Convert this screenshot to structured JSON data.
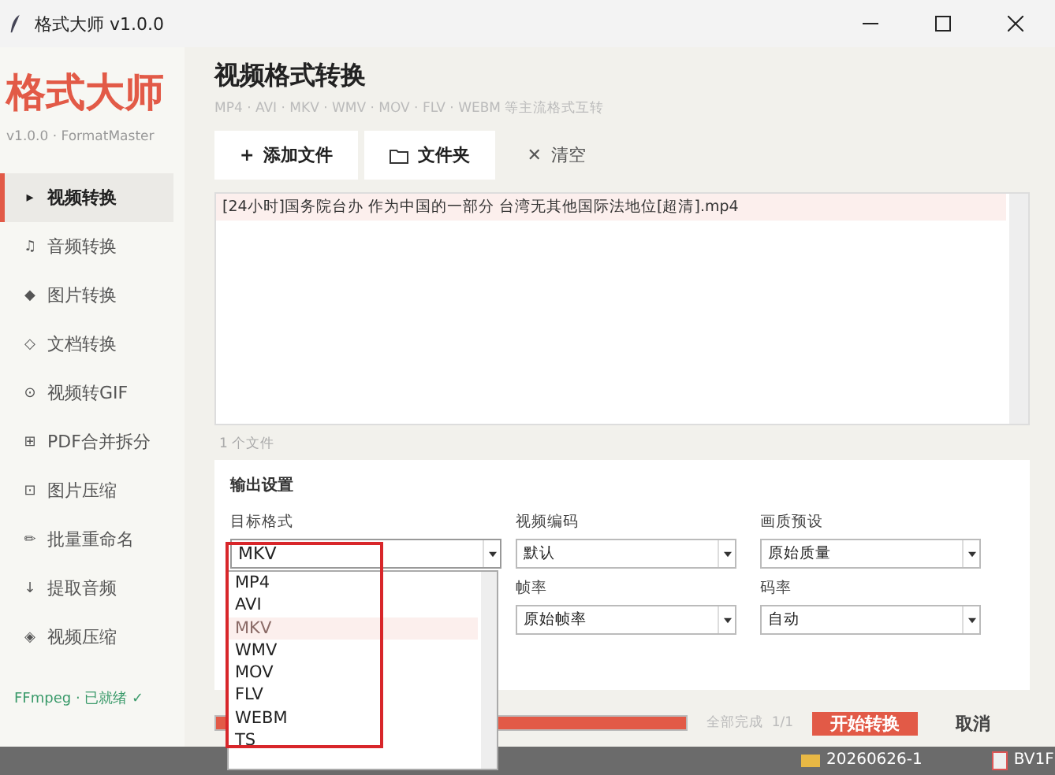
{
  "window": {
    "title": "格式大师 v1.0.0"
  },
  "sidebar": {
    "logo": "格式大师",
    "version": "v1.0.0 · FormatMaster",
    "items": [
      {
        "icon": "▸",
        "label": "视频转换",
        "selected": true
      },
      {
        "icon": "♫",
        "label": "音频转换",
        "selected": false
      },
      {
        "icon": "◆",
        "label": "图片转换",
        "selected": false
      },
      {
        "icon": "◇",
        "label": "文档转换",
        "selected": false
      },
      {
        "icon": "⊙",
        "label": "视频转GIF",
        "selected": false
      },
      {
        "icon": "⊞",
        "label": "PDF合并拆分",
        "selected": false
      },
      {
        "icon": "⊡",
        "label": "图片压缩",
        "selected": false
      },
      {
        "icon": "✏",
        "label": "批量重命名",
        "selected": false
      },
      {
        "icon": "↓",
        "label": "提取音频",
        "selected": false
      },
      {
        "icon": "◈",
        "label": "视频压缩",
        "selected": false
      }
    ],
    "status": "FFmpeg · 已就绪 ✓"
  },
  "header": {
    "title": "视频格式转换",
    "subtitle": "MP4 · AVI · MKV · WMV · MOV · FLV · WEBM 等主流格式互转"
  },
  "toolbar": [
    {
      "kind": "add",
      "icon": "+",
      "label": "添加文件"
    },
    {
      "kind": "folder",
      "label": "文件夹"
    },
    {
      "kind": "clear",
      "icon": "✕",
      "label": "清空"
    }
  ],
  "files": [
    {
      "name": "[24小时]国务院台办 作为中国的一部分 台湾无其他国际法地位[超清].mp4",
      "selected": true
    }
  ],
  "file_count": "1 个文件",
  "settings": {
    "title": "输出设置",
    "fields": [
      {
        "label": "目标格式",
        "value": "MKV",
        "open": true
      },
      {
        "label": "视频编码",
        "value": "默认",
        "open": false
      },
      {
        "label": "画质预设",
        "value": "原始质量",
        "open": false
      },
      {
        "label": "帧率",
        "value": "原始帧率",
        "open": false
      },
      {
        "label": "码率",
        "value": "自动",
        "open": false
      }
    ]
  },
  "format_options": [
    {
      "label": "MP4",
      "selected": false
    },
    {
      "label": "AVI",
      "selected": false
    },
    {
      "label": "MKV",
      "selected": true
    },
    {
      "label": "WMV",
      "selected": false
    },
    {
      "label": "MOV",
      "selected": false
    },
    {
      "label": "FLV",
      "selected": false
    },
    {
      "label": "WEBM",
      "selected": false
    },
    {
      "label": "TS",
      "selected": false
    }
  ],
  "progress": {
    "level": 1,
    "text": "全部完成  1/1"
  },
  "actions": {
    "start": "开始转换",
    "cancel": "取消"
  },
  "desktop": [
    {
      "kind": "folder",
      "label": "20260626-1"
    },
    {
      "kind": "file",
      "label": "BV1F"
    }
  ]
}
